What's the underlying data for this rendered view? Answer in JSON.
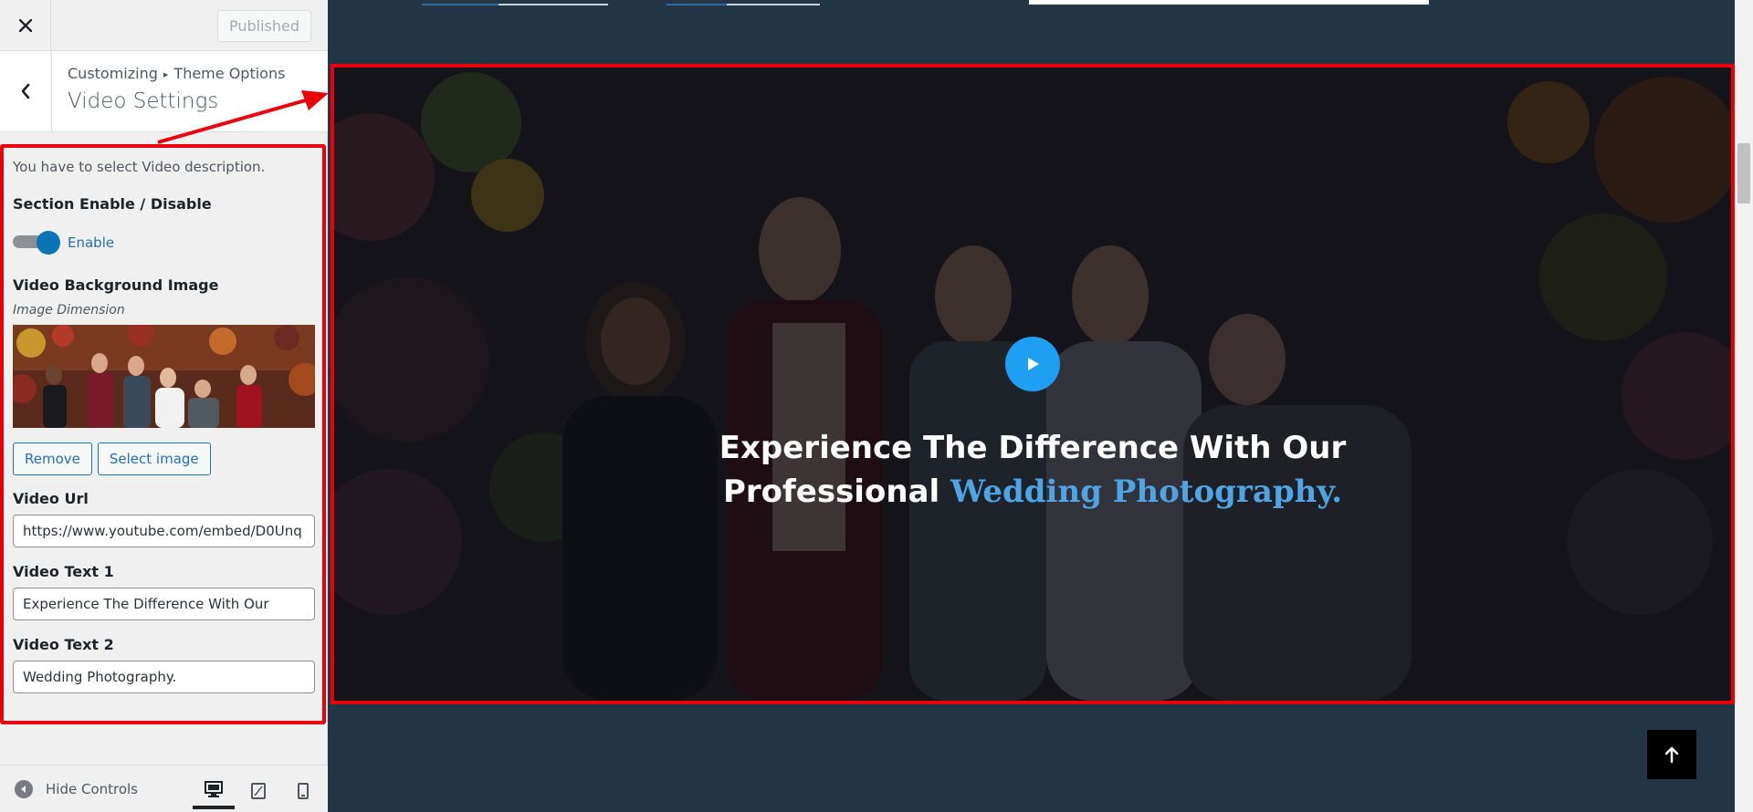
{
  "topbar": {
    "close_icon": "close-icon",
    "published_label": "Published"
  },
  "header": {
    "breadcrumb_root": "Customizing",
    "breadcrumb_separator": "▸",
    "breadcrumb_section": "Theme Options",
    "title": "Video Settings"
  },
  "controls": {
    "description": "You have to select Video description.",
    "section_label": "Section Enable / Disable",
    "toggle_label": "Enable",
    "toggle_on": true,
    "bg_image_label": "Video Background Image",
    "image_dimension": "Image Dimension",
    "remove_label": "Remove",
    "select_image_label": "Select image",
    "video_url_label": "Video Url",
    "video_url_value": "https://www.youtube.com/embed/D0Unq",
    "text1_label": "Video Text 1",
    "text1_value": "Experience The Difference With Our",
    "text2_label": "Video Text 2",
    "text2_value": "Wedding Photography."
  },
  "footer": {
    "hide_controls_label": "Hide Controls",
    "devices": [
      "desktop-icon",
      "tablet-icon",
      "mobile-icon"
    ],
    "active_device": "desktop"
  },
  "preview": {
    "line1": "Experience The Difference With Our",
    "line2_plain": "Professional",
    "line2_accent": "Wedding Photography."
  },
  "colors": {
    "accent_blue": "#4ea5e6",
    "play_button": "#1e9ff2",
    "highlight_red": "#e8000b",
    "wp_blue": "#2271b1",
    "preview_bg": "#233646"
  }
}
